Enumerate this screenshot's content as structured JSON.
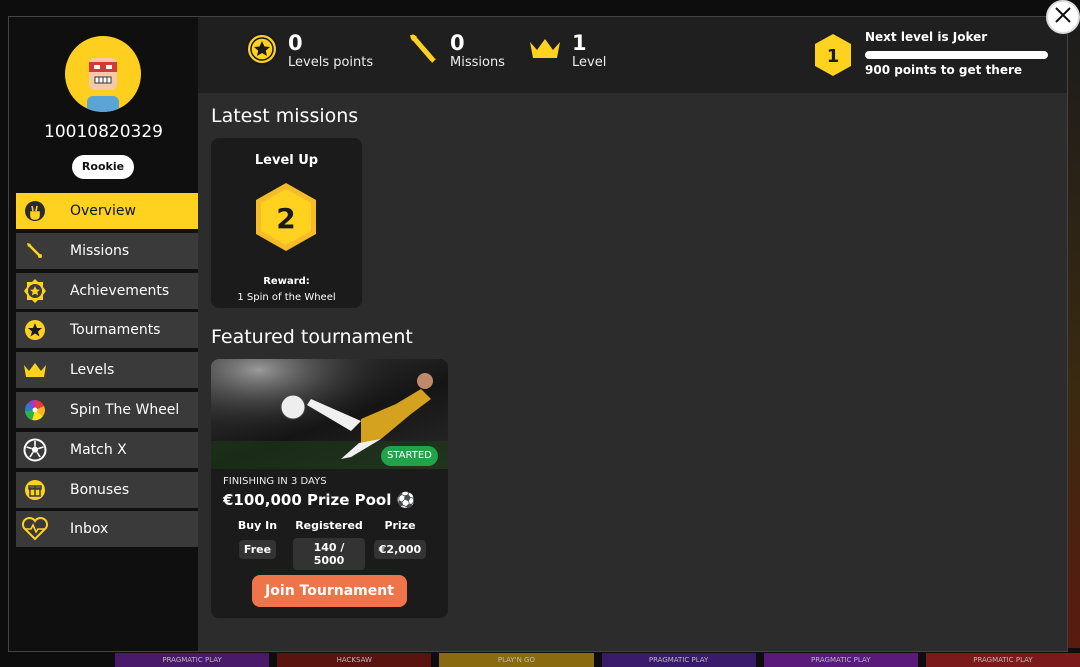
{
  "user": {
    "id": "10010820329",
    "rank": "Rookie"
  },
  "nav": [
    {
      "label": "Overview",
      "icon": "hand-peace-icon",
      "active": true
    },
    {
      "label": "Missions",
      "icon": "dart-icon"
    },
    {
      "label": "Achievements",
      "icon": "achievement-badge-icon"
    },
    {
      "label": "Tournaments",
      "icon": "star-coin-icon"
    },
    {
      "label": "Levels",
      "icon": "crown-icon"
    },
    {
      "label": "Spin The Wheel",
      "icon": "color-wheel-icon"
    },
    {
      "label": "Match X",
      "icon": "soccer-ball-icon"
    },
    {
      "label": "Bonuses",
      "icon": "gift-icon"
    },
    {
      "label": "Inbox",
      "icon": "heart-pulse-icon"
    }
  ],
  "stats": {
    "levels_points": {
      "value": "0",
      "label": "Levels points"
    },
    "missions": {
      "value": "0",
      "label": "Missions"
    },
    "level": {
      "value": "1",
      "label": "Level"
    }
  },
  "next_level": {
    "current_level": "1",
    "title": "Next level is Joker",
    "subtitle": "900 points to get there",
    "progress_fraction": 0
  },
  "latest_missions": {
    "heading": "Latest missions",
    "card": {
      "title": "Level Up",
      "level": "2",
      "reward_label": "Reward:",
      "reward": "1 Spin of the Wheel"
    }
  },
  "featured": {
    "heading": "Featured tournament",
    "status": "STARTED",
    "finishing": "FINISHING IN 3 DAYS",
    "name": "€100,000 Prize Pool ⚽",
    "columns": [
      {
        "header": "Buy In",
        "value": "Free"
      },
      {
        "header": "Registered",
        "value": "140 / 5000"
      },
      {
        "header": "Prize",
        "value": "€2,000"
      }
    ],
    "join_label": "Join Tournament"
  },
  "background_tiles": [
    "PRAGMATIC PLAY",
    "HACKSAW",
    "PLAY'N GO",
    "PRAGMATIC PLAY",
    "PRAGMATIC PLAY",
    "PRAGMATIC PLAY"
  ],
  "colors": {
    "accent": "#ffd21f",
    "button": "#ee7549",
    "started": "#21a34a"
  }
}
